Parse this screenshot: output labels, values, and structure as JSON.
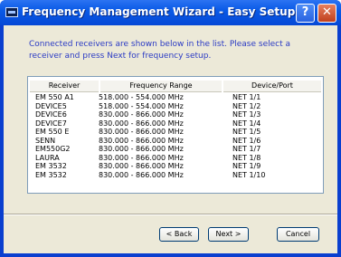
{
  "window": {
    "title": "Frequency Management Wizard - Easy Setup",
    "help_label": "?",
    "close_label": "✕"
  },
  "intro": {
    "line1": "Connected receivers are shown below in the list. Please select a",
    "line2": "receiver and press Next for frequency setup."
  },
  "list": {
    "columns": [
      "Receiver",
      "Frequency Range",
      "Device/Port"
    ],
    "rows": [
      [
        "EM 550 A1",
        "518.000 - 554.000 MHz",
        "NET 1/1"
      ],
      [
        "DEVICE5",
        "518.000 - 554.000 MHz",
        "NET 1/2"
      ],
      [
        "DEVICE6",
        "830.000 - 866.000 MHz",
        "NET 1/3"
      ],
      [
        "DEVICE7",
        "830.000 - 866.000 MHz",
        "NET 1/4"
      ],
      [
        "EM 550 E",
        "830.000 - 866.000 MHz",
        "NET 1/5"
      ],
      [
        "SENN",
        "830.000 - 866.000 MHz",
        "NET 1/6"
      ],
      [
        "EM550G2",
        "830.000 - 866.000 MHz",
        "NET 1/7"
      ],
      [
        "LAURA",
        "830.000 - 866.000 MHz",
        "NET 1/8"
      ],
      [
        "EM 3532",
        "830.000 - 866.000 MHz",
        "NET 1/9"
      ],
      [
        "EM 3532",
        "830.000 - 866.000 MHz",
        "NET 1/10"
      ]
    ]
  },
  "buttons": {
    "back": "< Back",
    "next": "Next >",
    "cancel": "Cancel"
  },
  "icons": {
    "title": "app-window-icon",
    "help": "help-icon",
    "close": "close-icon"
  },
  "colors": {
    "titlebar": "#0a5ae6",
    "intro_text": "#2b3bc4",
    "dialog_bg": "#ece9d8"
  }
}
